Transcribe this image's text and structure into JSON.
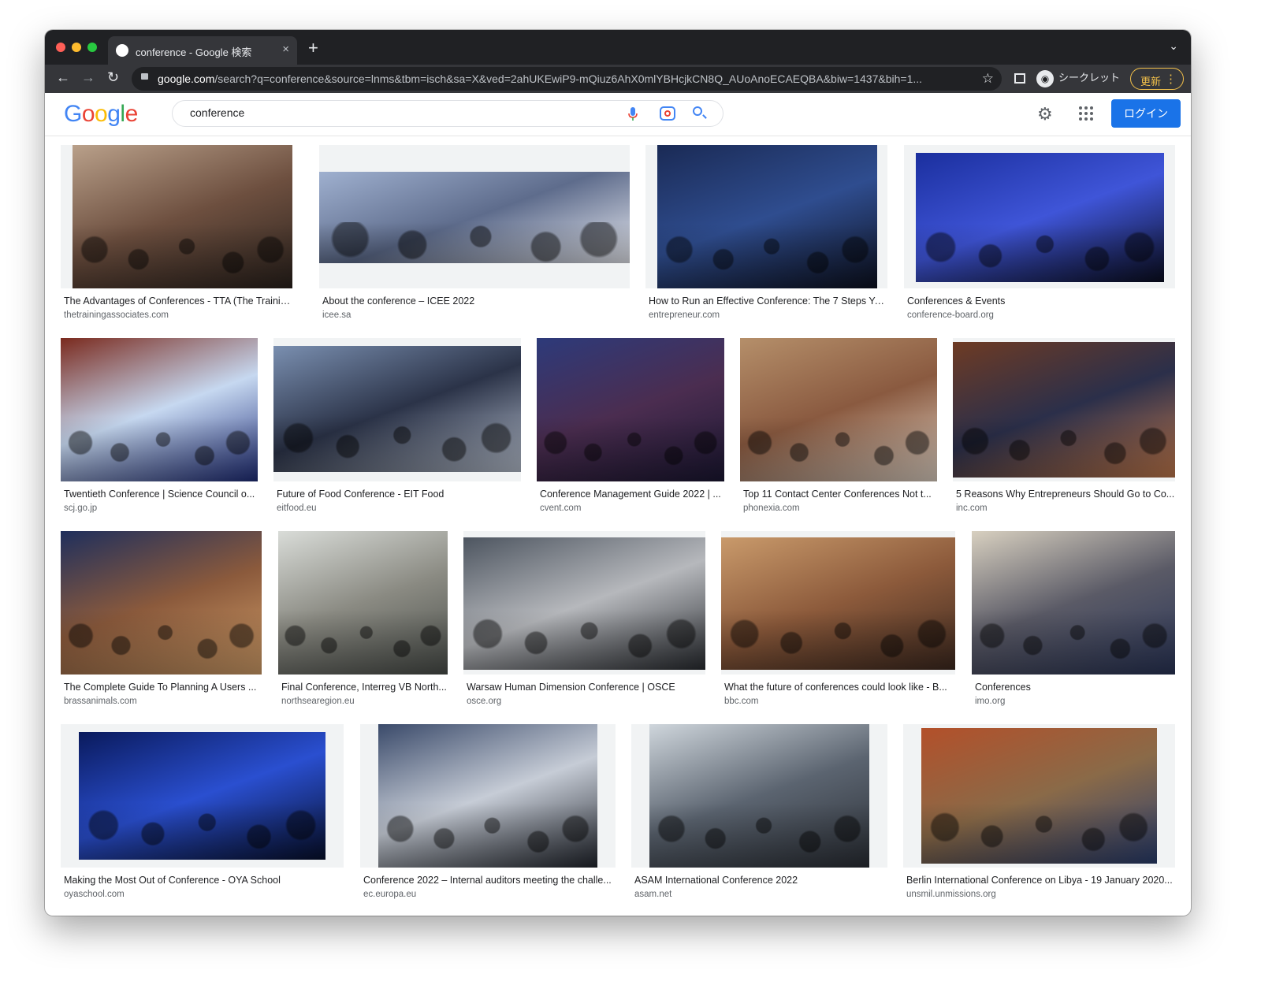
{
  "browser": {
    "tab_title": "conference - Google 検索",
    "new_tab": "+",
    "tab_close": "×",
    "url_domain": "google.com",
    "url_path": "/search?q=conference&source=lnms&tbm=isch&sa=X&ved=2ahUKEwiP9-mQiuz6AhX0mlYBHcjkCN8Q_AUoAnoECAEQBA&biw=1437&bih=1...",
    "incognito_label": "シークレット",
    "update_label": "更新"
  },
  "google": {
    "logo_letters": [
      {
        "ch": "G",
        "color": "#4285f4"
      },
      {
        "ch": "o",
        "color": "#ea4335"
      },
      {
        "ch": "o",
        "color": "#fbbc05"
      },
      {
        "ch": "g",
        "color": "#4285f4"
      },
      {
        "ch": "l",
        "color": "#34a853"
      },
      {
        "ch": "e",
        "color": "#ea4335"
      }
    ],
    "query": "conference",
    "login_label": "ログイン"
  },
  "results": [
    {
      "caption": "The Advantages of Conferences - TTA (The Training ...",
      "source": "thetrainingassociates.com"
    },
    {
      "caption": "About the conference – ICEE 2022",
      "source": "icee.sa"
    },
    {
      "caption": "How to Run an Effective Conference: The 7 Steps Yo...",
      "source": "entrepreneur.com"
    },
    {
      "caption": "Conferences & Events",
      "source": "conference-board.org"
    },
    {
      "caption": "Twentieth Conference | Science Council o...",
      "source": "scj.go.jp"
    },
    {
      "caption": "Future of Food Conference - EIT Food",
      "source": "eitfood.eu"
    },
    {
      "caption": "Conference Management Guide 2022 | ...",
      "source": "cvent.com"
    },
    {
      "caption": "Top 11 Contact Center Conferences Not t...",
      "source": "phonexia.com"
    },
    {
      "caption": "5 Reasons Why Entrepreneurs Should Go to Co...",
      "source": "inc.com"
    },
    {
      "caption": "The Complete Guide To Planning A Users ...",
      "source": "brassanimals.com"
    },
    {
      "caption": "Final Conference, Interreg VB North...",
      "source": "northsearegion.eu"
    },
    {
      "caption": "Warsaw Human Dimension Conference | OSCE",
      "source": "osce.org"
    },
    {
      "caption": "What the future of conferences could look like - B...",
      "source": "bbc.com"
    },
    {
      "caption": "Conferences",
      "source": "imo.org"
    },
    {
      "caption": "Making the Most Out of Conference - OYA School",
      "source": "oyaschool.com"
    },
    {
      "caption": "Conference 2022 – Internal auditors meeting the challe...",
      "source": "ec.europa.eu"
    },
    {
      "caption": "ASAM International Conference 2022",
      "source": "asam.net"
    },
    {
      "caption": "Berlin International Conference on Libya - 19 January 2020...",
      "source": "unsmil.unmissions.org"
    }
  ]
}
